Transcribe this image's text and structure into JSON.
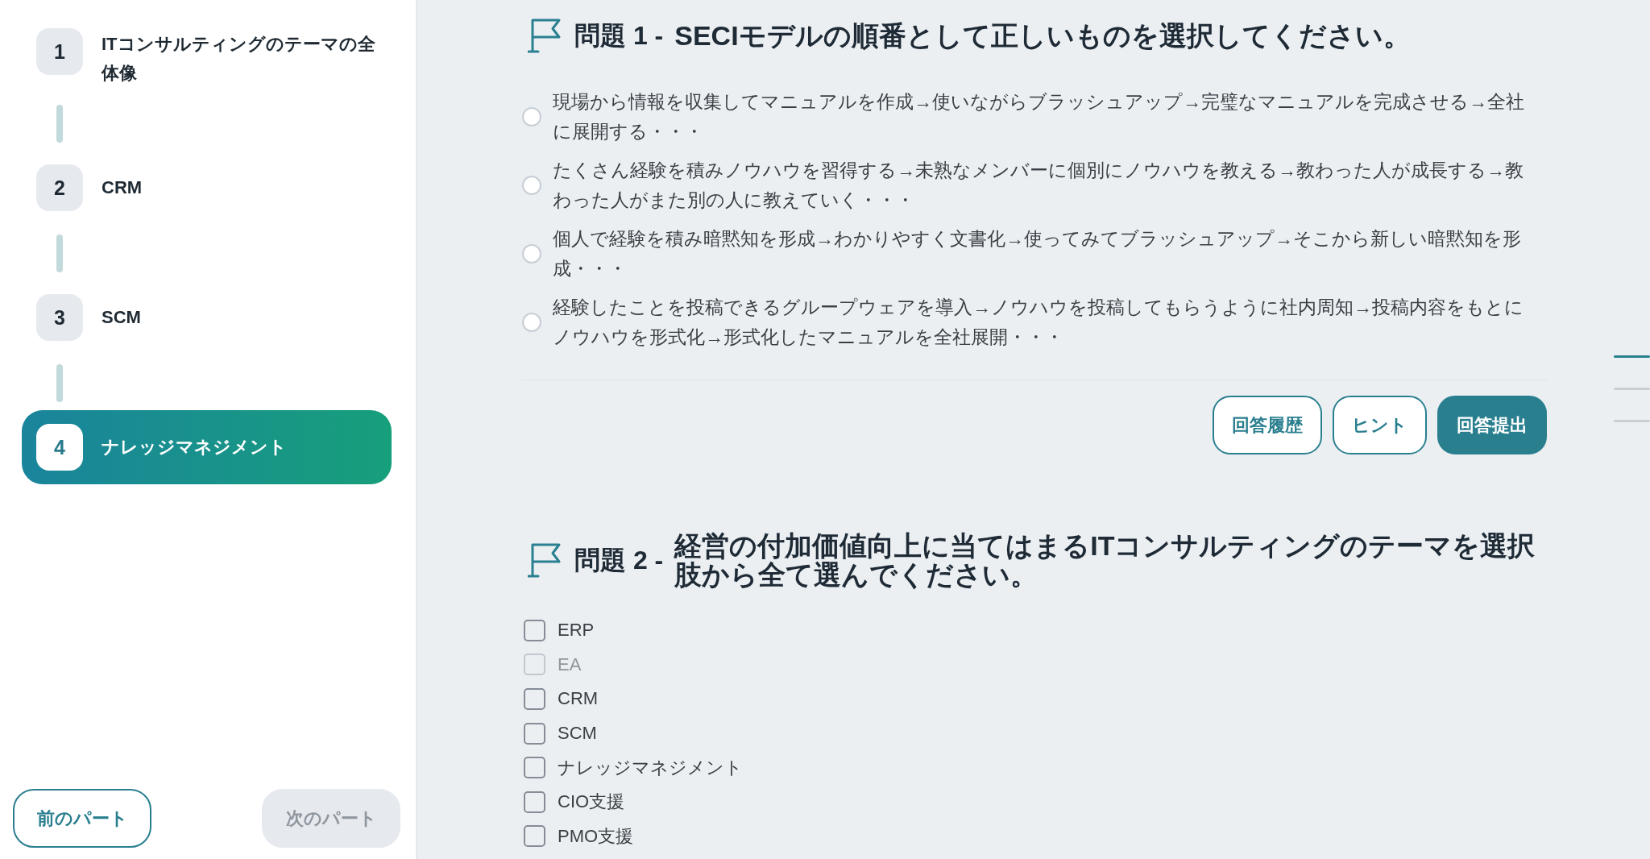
{
  "sidebar": {
    "steps": [
      {
        "number": "1",
        "label": "ITコンサルティングのテーマの全体像",
        "selected": false
      },
      {
        "number": "2",
        "label": "CRM",
        "selected": false
      },
      {
        "number": "3",
        "label": "SCM",
        "selected": false
      },
      {
        "number": "4",
        "label": "ナレッジマネジメント",
        "selected": true
      }
    ],
    "buttons": [
      {
        "label": "前のパート",
        "disabled": false
      },
      {
        "label": "次のパート",
        "disabled": true
      }
    ]
  },
  "questions": [
    {
      "label": "問題 1 -",
      "title": "SECIモデルの順番として正しいものを選択してください。",
      "kind": "single",
      "options": [
        {
          "text": "現場から情報を収集してマニュアルを作成→使いながらブラッシュアップ→完璧なマニュアルを完成させる→全社に展開する・・・",
          "selected": false
        },
        {
          "text": "たくさん経験を積みノウハウを習得する→未熟なメンバーに個別にノウハウを教える→教わった人が成長する→教わった人がまた別の人に教えていく・・・",
          "selected": false
        },
        {
          "text": "個人で経験を積み暗黙知を形成→わかりやすく文書化→使ってみてブラッシュアップ→そこから新しい暗黙知を形成・・・",
          "selected": false
        },
        {
          "text": "経験したことを投稿できるグループウェアを導入→ノウハウを投稿してもらうように社内周知→投稿内容をもとにノウハウを形式化→形式化したマニュアルを全社展開・・・",
          "selected": false
        }
      ],
      "actions": [
        {
          "label": "回答履歴",
          "kind": "outline"
        },
        {
          "label": "ヒント",
          "kind": "outline"
        },
        {
          "label": "回答提出",
          "kind": "primary"
        }
      ]
    },
    {
      "label": "問題 2 -",
      "title": "経営の付加価値向上に当てはまるITコンサルティングのテーマを選択肢から全て選んでください。",
      "kind": "multiple",
      "options": [
        {
          "text": "ERP",
          "checked": false,
          "disabled": false
        },
        {
          "text": "EA",
          "checked": false,
          "disabled": true
        },
        {
          "text": "CRM",
          "checked": false,
          "disabled": false
        },
        {
          "text": "SCM",
          "checked": false,
          "disabled": false
        },
        {
          "text": "ナレッジマネジメント",
          "checked": false,
          "disabled": false
        },
        {
          "text": "CIO支援",
          "checked": false,
          "disabled": false
        },
        {
          "text": "PMO支援",
          "checked": false,
          "disabled": false
        }
      ]
    }
  ],
  "page_indicator": [
    {
      "selected": true
    },
    {
      "selected": false
    },
    {
      "selected": false
    }
  ]
}
